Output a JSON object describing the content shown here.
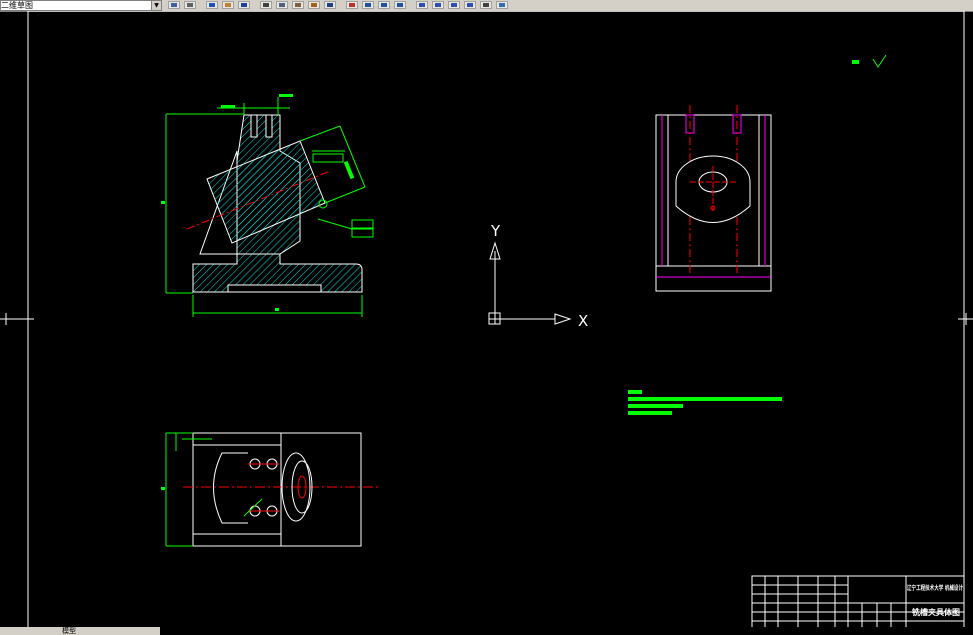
{
  "toolbar": {
    "workspace": "二维草图",
    "buttons": [
      {
        "icon": "layer-manager-icon",
        "color": "#4060a0"
      },
      {
        "icon": "layer-state-icon",
        "color": "#606060"
      },
      {
        "icon": "new-icon",
        "color": "#2050c0"
      },
      {
        "icon": "open-icon",
        "color": "#c08030"
      },
      {
        "icon": "save-icon",
        "color": "#2040a0"
      },
      {
        "icon": "cut-icon",
        "color": "#404040"
      },
      {
        "icon": "copy-icon",
        "color": "#506080"
      },
      {
        "icon": "paste-icon",
        "color": "#806040"
      },
      {
        "icon": "match-properties-icon",
        "color": "#a06020"
      },
      {
        "icon": "undo-icon",
        "color": "#204080"
      },
      {
        "icon": "pan-icon",
        "color": "#c03030"
      },
      {
        "icon": "zoom-realtime-icon",
        "color": "#2050a0"
      },
      {
        "icon": "zoom-window-icon",
        "color": "#2050a0"
      },
      {
        "icon": "zoom-previous-icon",
        "color": "#2050a0"
      },
      {
        "icon": "text-style-icon",
        "color": "#3050b0"
      },
      {
        "icon": "dim-style-icon",
        "color": "#3050b0"
      },
      {
        "icon": "table-style-icon",
        "color": "#3050b0"
      },
      {
        "icon": "multileader-style-icon",
        "color": "#3050b0"
      },
      {
        "icon": "grid-icon",
        "color": "#404040"
      },
      {
        "icon": "properties-icon",
        "color": "#3070b0"
      }
    ]
  },
  "drawing": {
    "title_block": {
      "school": "辽宁工程技术大学 机械设计",
      "drawing_name": "铣槽夹具体图"
    },
    "ucs": {
      "x_label": "X",
      "y_label": "Y"
    }
  },
  "status_bar": {
    "model_tab": "模型"
  },
  "colors": {
    "background": "#000000",
    "geometry": "#ffffff",
    "dimension": "#00ff00",
    "centerline": "#ff0000",
    "hidden": "#ff00ff",
    "hatch": "#00e0e0"
  }
}
